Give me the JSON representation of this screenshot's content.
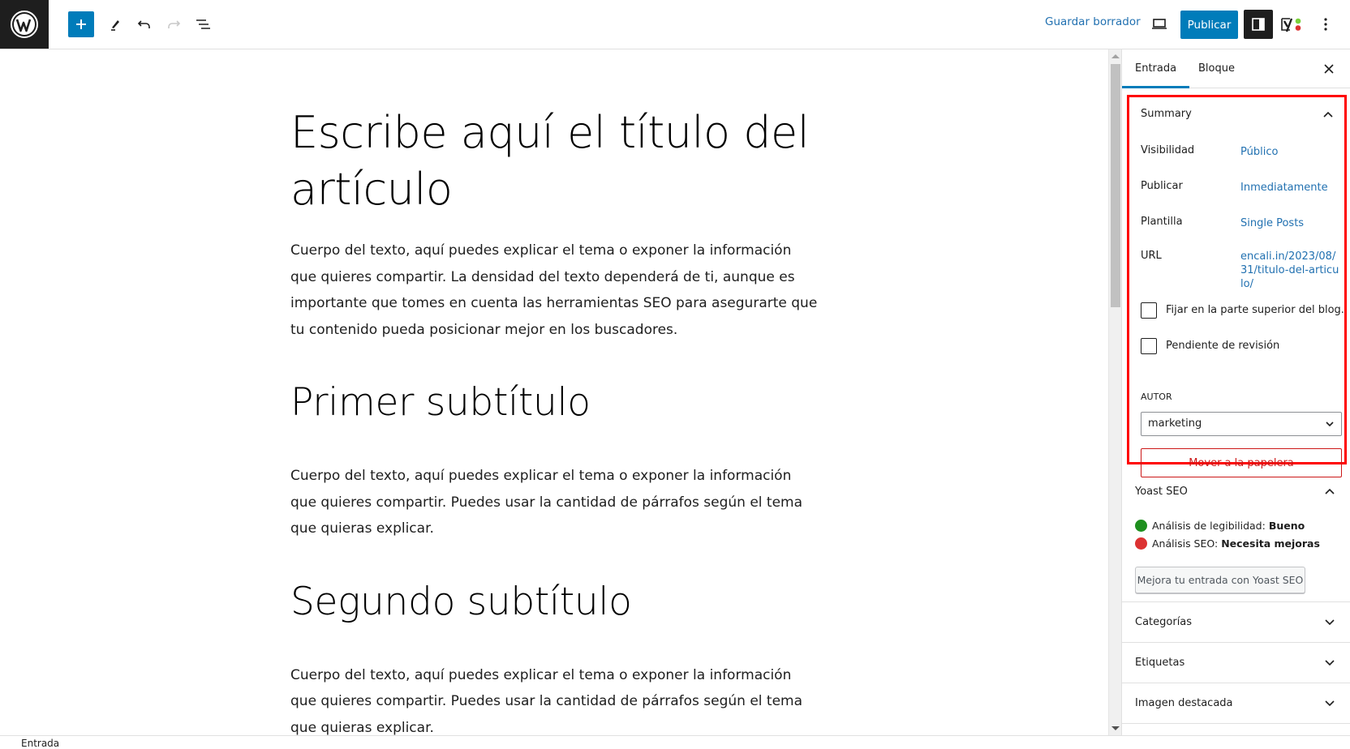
{
  "header": {
    "logo": "wordpress-logo",
    "toolbar_icons": [
      "add-block-icon",
      "pencil-icon",
      "undo-icon",
      "redo-icon",
      "document-overview-icon"
    ],
    "save_draft": "Guardar borrador",
    "preview_icon": "laptop-icon",
    "publish": "Publicar",
    "settings_icon": "sidebar-toggle-icon",
    "yoast_icon": "yoast-icon",
    "more_icon": "kebab-icon"
  },
  "post": {
    "title": "Escribe aquí el título del artículo",
    "blocks": [
      {
        "type": "p",
        "text": "Cuerpo del texto, aquí puedes explicar el tema o exponer la información que quieres compartir. La densidad del texto dependerá de ti, aunque es importante que tomes en cuenta las herramientas SEO para asegurarte que tu contenido pueda posicionar mejor en los buscadores."
      },
      {
        "type": "h2",
        "text": "Primer subtítulo"
      },
      {
        "type": "p",
        "text": "Cuerpo del texto, aquí puedes explicar el tema o exponer la información que quieres compartir. Puedes usar la cantidad de párrafos según el tema que quieras explicar."
      },
      {
        "type": "h2",
        "text": "Segundo subtítulo"
      },
      {
        "type": "p",
        "text": "Cuerpo del texto, aquí puedes explicar el tema o exponer la información que quieres compartir. Puedes usar la cantidad de párrafos según el tema que quieras explicar."
      }
    ]
  },
  "sidebar": {
    "tabs": [
      {
        "label": "Entrada",
        "active": true
      },
      {
        "label": "Bloque",
        "active": false
      }
    ],
    "summary": {
      "title": "Summary",
      "rows": [
        {
          "label": "Visibilidad",
          "value": "Público"
        },
        {
          "label": "Publicar",
          "value": "Inmediatamente"
        },
        {
          "label": "Plantilla",
          "value": "Single Posts"
        },
        {
          "label": "URL",
          "value": "encali.in/2023/08/31/titulo-del-articulo/"
        }
      ],
      "checkboxes": [
        {
          "label": "Fijar en la parte superior del blog.",
          "checked": false
        },
        {
          "label": "Pendiente de revisión",
          "checked": false
        }
      ],
      "author_label": "Autor",
      "author_value": "marketing",
      "trash": "Mover a la papelera",
      "highlight_color": "#ff0000"
    },
    "yoast": {
      "title": "Yoast SEO",
      "readability_label": "Análisis de legibilidad:",
      "readability_value": "Bueno",
      "readability_color": "#1e8f1e",
      "seo_label": "Análisis SEO:",
      "seo_value": "Necesita mejoras",
      "seo_color": "#dc3232",
      "button": "Mejora tu entrada con Yoast SEO"
    },
    "panels": [
      {
        "title": "Categorías"
      },
      {
        "title": "Etiquetas"
      },
      {
        "title": "Imagen destacada"
      }
    ]
  },
  "footer": {
    "breadcrumb": "Entrada"
  },
  "colors": {
    "accent": "#007cba",
    "link": "#2271b1",
    "danger": "#cc1818",
    "dark": "#1e1e1e"
  }
}
